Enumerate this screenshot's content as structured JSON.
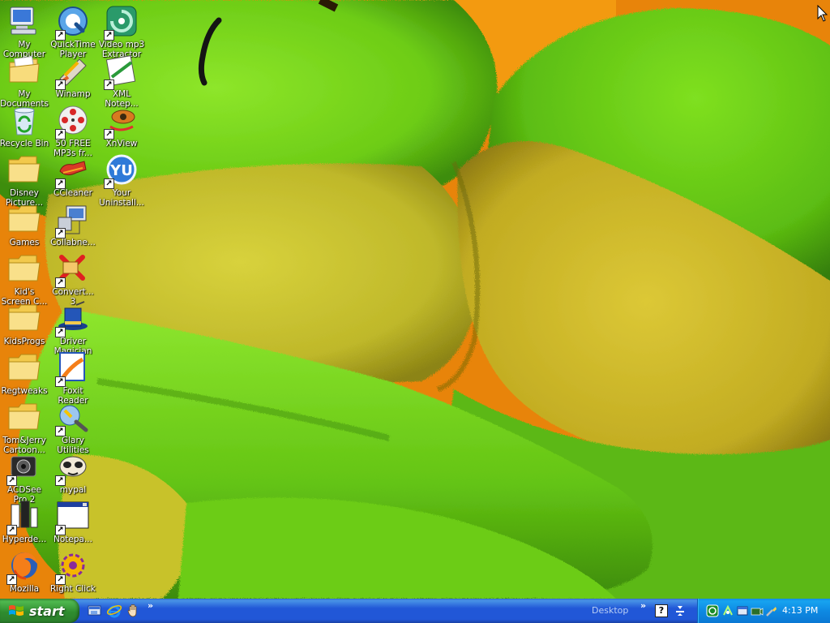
{
  "desktop": {
    "icons_col1": [
      {
        "label": "My\nComputer",
        "icon": "my-computer-icon"
      },
      {
        "label": "My\nDocuments",
        "icon": "my-documents-icon"
      },
      {
        "label": "Recycle Bin",
        "icon": "recycle-bin-icon"
      },
      {
        "label": "Disney\nPicture...",
        "icon": "folder-icon"
      },
      {
        "label": "Games",
        "icon": "folder-icon"
      },
      {
        "label": "Kid's\nScreen C...",
        "icon": "folder-icon"
      },
      {
        "label": "KidsProgs",
        "icon": "folder-icon"
      },
      {
        "label": "Regtweaks",
        "icon": "folder-icon"
      },
      {
        "label": "Tom&Jerry\nCartoon...",
        "icon": "folder-icon"
      },
      {
        "label": "ACDSee\nPro 2",
        "icon": "acdsee-icon"
      },
      {
        "label": "Hyperde...",
        "icon": "hyperdesk-icon"
      },
      {
        "label": "Mozilla",
        "icon": "firefox-icon"
      }
    ],
    "icons_col2": [
      {
        "label": "QuickTime\nPlayer",
        "icon": "quicktime-icon"
      },
      {
        "label": "Winamp",
        "icon": "winamp-icon"
      },
      {
        "label": "50 FREE\nMP3s fr...",
        "icon": "film-reel-icon"
      },
      {
        "label": "CCleaner",
        "icon": "ccleaner-icon"
      },
      {
        "label": "Collabne...",
        "icon": "network-computer-icon"
      },
      {
        "label": "Convert...\n3",
        "icon": "converter-icon"
      },
      {
        "label": "Driver\nMagician",
        "icon": "magician-hat-icon"
      },
      {
        "label": "Foxit\nReader",
        "icon": "foxit-icon"
      },
      {
        "label": "Glary\nUtilities",
        "icon": "glary-icon"
      },
      {
        "label": "mypal",
        "icon": "mypal-icon"
      },
      {
        "label": "Notepa...",
        "icon": "notepad-window-icon"
      },
      {
        "label": "Right Click",
        "icon": "right-click-icon"
      }
    ],
    "icons_col3": [
      {
        "label": "Video mp3\nExtractor",
        "icon": "video-mp3-icon"
      },
      {
        "label": "XML\nNotep...",
        "icon": "xml-notepad-icon"
      },
      {
        "label": "XnView",
        "icon": "xnview-icon"
      },
      {
        "label": "Your\nUninstall...",
        "icon": "your-uninstaller-icon"
      }
    ]
  },
  "taskbar": {
    "start_label": "start",
    "quick_launch": [
      "show-desktop-icon",
      "internet-explorer-icon",
      "hand-icon"
    ],
    "chevron": "»",
    "desktop_toolbar_label": "Desktop",
    "help_label": "?",
    "clock": "4:13 PM",
    "tray_icons": [
      "refresh-icon",
      "network-icon",
      "window-icon",
      "camera-icon",
      "tools-icon"
    ]
  },
  "colors": {
    "taskbar_blue": "#2157d7",
    "start_green": "#2f8d2f",
    "tray_blue": "#0e8ae3",
    "wallpaper_green": "#72d41a",
    "wallpaper_yellow": "#c9c832",
    "wallpaper_orange": "#f08a0a"
  }
}
